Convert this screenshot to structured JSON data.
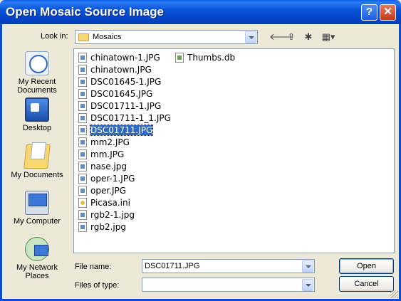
{
  "window": {
    "title": "Open Mosaic Source Image",
    "help_btn": "?",
    "close_btn": "✕"
  },
  "lookin": {
    "label": "Look in:",
    "value": "Mosaics"
  },
  "toolbar": {
    "back_icon": "🡐",
    "up_icon": "⇧",
    "newfolder_icon": "✱",
    "views_icon": "▦▾"
  },
  "places": [
    {
      "label": "My Recent Documents",
      "icon": "recent-documents-icon"
    },
    {
      "label": "Desktop",
      "icon": "desktop-icon"
    },
    {
      "label": "My Documents",
      "icon": "my-documents-icon"
    },
    {
      "label": "My Computer",
      "icon": "my-computer-icon"
    },
    {
      "label": "My Network Places",
      "icon": "network-places-icon"
    }
  ],
  "files": [
    {
      "name": "chinatown-1.JPG",
      "type": "jpg"
    },
    {
      "name": "chinatown.JPG",
      "type": "jpg"
    },
    {
      "name": "DSC01645-1.JPG",
      "type": "jpg"
    },
    {
      "name": "DSC01645.JPG",
      "type": "jpg"
    },
    {
      "name": "DSC01711-1.JPG",
      "type": "jpg"
    },
    {
      "name": "DSC01711-1_1.JPG",
      "type": "jpg"
    },
    {
      "name": "DSC01711.JPG",
      "type": "jpg",
      "selected": true
    },
    {
      "name": "mm2.JPG",
      "type": "jpg"
    },
    {
      "name": "mm.JPG",
      "type": "jpg"
    },
    {
      "name": "nase.jpg",
      "type": "jpg"
    },
    {
      "name": "oper-1.JPG",
      "type": "jpg"
    },
    {
      "name": "oper.JPG",
      "type": "jpg"
    },
    {
      "name": "Picasa.ini",
      "type": "ini"
    },
    {
      "name": "rgb2-1.jpg",
      "type": "jpg"
    },
    {
      "name": "rgb2.jpg",
      "type": "jpg"
    },
    {
      "name": "Thumbs.db",
      "type": "db"
    }
  ],
  "filename": {
    "label": "File name:",
    "value": "DSC01711.JPG"
  },
  "filetype": {
    "label": "Files of type:",
    "value": ""
  },
  "buttons": {
    "open": "Open",
    "cancel": "Cancel"
  },
  "colors": {
    "titlebar": "#0A54D8",
    "selection": "#316AC5",
    "dialog_bg": "#ECE9D8"
  }
}
